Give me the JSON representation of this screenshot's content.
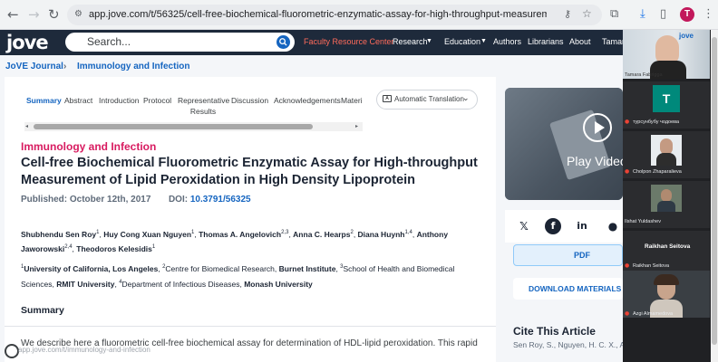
{
  "browser": {
    "url": "app.jove.com/t/56325/cell-free-biochemical-fluorometric-enzymatic-assay-for-high-throughput-measurement-of-lipid-peroxidation-i...",
    "profile_initial": "T"
  },
  "site_header": {
    "logo": "jove",
    "search_placeholder": "Search...",
    "faculty_link": "Faculty Resource Center",
    "nav": [
      "Research",
      "Education",
      "Authors",
      "Librarians",
      "About",
      "Tamar"
    ]
  },
  "breadcrumb": [
    "JoVE Journal",
    "Immunology and Infection"
  ],
  "tabs": [
    "Summary",
    "Abstract",
    "Introduction",
    "Protocol",
    "Representative Results",
    "Discussion",
    "Acknowledgements",
    "Materi"
  ],
  "translate_label": "Automatic Translation",
  "article": {
    "category": "Immunology and Infection",
    "title": "Cell-free Biochemical Fluorometric Enzymatic Assay for High-throughput Measurement of Lipid Peroxidation in High Density Lipoprotein",
    "published": "Published: October 12th, 2017",
    "doi_label": "DOI:",
    "doi": "10.3791/56325",
    "authors": [
      {
        "name": "Shubhendu Sen Roy",
        "sup": "1"
      },
      {
        "name": "Huy Cong Xuan Nguyen",
        "sup": "1"
      },
      {
        "name": "Thomas A. Angelovich",
        "sup": "2,3"
      },
      {
        "name": "Anna C. Hearps",
        "sup": "2"
      },
      {
        "name": "Diana Huynh",
        "sup": "1,4"
      },
      {
        "name": "Anthony Jaworowski",
        "sup": "2,4"
      },
      {
        "name": "Theodoros Kelesidis",
        "sup": "1"
      }
    ],
    "affiliations": [
      {
        "sup": "1",
        "bold": "University of California, Los Angeles",
        "rest": ", "
      },
      {
        "sup": "2",
        "bold": "",
        "rest": "Centre for Biomedical Research, "
      },
      {
        "sup": "",
        "bold": "Burnet Institute",
        "rest": ", "
      },
      {
        "sup": "3",
        "bold": "",
        "rest": "School of Health and Biomedical Sciences, "
      },
      {
        "sup": "",
        "bold": "RMIT University",
        "rest": ", "
      },
      {
        "sup": "4",
        "bold": "",
        "rest": "Department of Infectious Diseases, "
      },
      {
        "sup": "",
        "bold": "Monash University",
        "rest": ""
      }
    ],
    "summary_heading": "Summary",
    "summary_text": "We describe here a fluorometric cell-free biochemical assay for determination of HDL-lipid peroxidation. This rapid"
  },
  "video": {
    "label": "Play Video"
  },
  "sidebar": {
    "pdf_label": "PDF",
    "download_label": "DOWNLOAD MATERIALS LI",
    "cite_heading": "Cite This Article",
    "cite_text": "Sen Roy, S., Nguyen, H. C. X., Angelovic..."
  },
  "meeting": {
    "participants": [
      {
        "name": "Tamara Fabrigga",
        "initial": ""
      },
      {
        "name": "турсунбубу чодоева",
        "initial": "T"
      },
      {
        "name": "Cholpon Zhaparalieva",
        "initial": ""
      },
      {
        "name": "Ilshat Yuldashev",
        "initial": ""
      },
      {
        "name": "Raikhan Seitova",
        "initial": ""
      },
      {
        "name": "Azgi Almamedova",
        "initial": ""
      }
    ]
  },
  "status_url": "app.jove.com/t/immunology-and-infection"
}
